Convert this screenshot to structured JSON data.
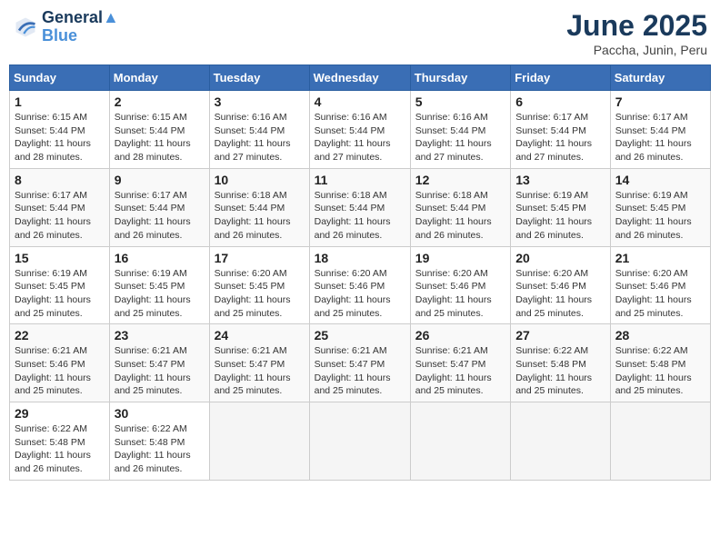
{
  "logo": {
    "line1": "General",
    "line2": "Blue"
  },
  "title": "June 2025",
  "subtitle": "Paccha, Junin, Peru",
  "days_of_week": [
    "Sunday",
    "Monday",
    "Tuesday",
    "Wednesday",
    "Thursday",
    "Friday",
    "Saturday"
  ],
  "weeks": [
    [
      {
        "day": 1,
        "info": "Sunrise: 6:15 AM\nSunset: 5:44 PM\nDaylight: 11 hours\nand 28 minutes."
      },
      {
        "day": 2,
        "info": "Sunrise: 6:15 AM\nSunset: 5:44 PM\nDaylight: 11 hours\nand 28 minutes."
      },
      {
        "day": 3,
        "info": "Sunrise: 6:16 AM\nSunset: 5:44 PM\nDaylight: 11 hours\nand 27 minutes."
      },
      {
        "day": 4,
        "info": "Sunrise: 6:16 AM\nSunset: 5:44 PM\nDaylight: 11 hours\nand 27 minutes."
      },
      {
        "day": 5,
        "info": "Sunrise: 6:16 AM\nSunset: 5:44 PM\nDaylight: 11 hours\nand 27 minutes."
      },
      {
        "day": 6,
        "info": "Sunrise: 6:17 AM\nSunset: 5:44 PM\nDaylight: 11 hours\nand 27 minutes."
      },
      {
        "day": 7,
        "info": "Sunrise: 6:17 AM\nSunset: 5:44 PM\nDaylight: 11 hours\nand 26 minutes."
      }
    ],
    [
      {
        "day": 8,
        "info": "Sunrise: 6:17 AM\nSunset: 5:44 PM\nDaylight: 11 hours\nand 26 minutes."
      },
      {
        "day": 9,
        "info": "Sunrise: 6:17 AM\nSunset: 5:44 PM\nDaylight: 11 hours\nand 26 minutes."
      },
      {
        "day": 10,
        "info": "Sunrise: 6:18 AM\nSunset: 5:44 PM\nDaylight: 11 hours\nand 26 minutes."
      },
      {
        "day": 11,
        "info": "Sunrise: 6:18 AM\nSunset: 5:44 PM\nDaylight: 11 hours\nand 26 minutes."
      },
      {
        "day": 12,
        "info": "Sunrise: 6:18 AM\nSunset: 5:44 PM\nDaylight: 11 hours\nand 26 minutes."
      },
      {
        "day": 13,
        "info": "Sunrise: 6:19 AM\nSunset: 5:45 PM\nDaylight: 11 hours\nand 26 minutes."
      },
      {
        "day": 14,
        "info": "Sunrise: 6:19 AM\nSunset: 5:45 PM\nDaylight: 11 hours\nand 26 minutes."
      }
    ],
    [
      {
        "day": 15,
        "info": "Sunrise: 6:19 AM\nSunset: 5:45 PM\nDaylight: 11 hours\nand 25 minutes."
      },
      {
        "day": 16,
        "info": "Sunrise: 6:19 AM\nSunset: 5:45 PM\nDaylight: 11 hours\nand 25 minutes."
      },
      {
        "day": 17,
        "info": "Sunrise: 6:20 AM\nSunset: 5:45 PM\nDaylight: 11 hours\nand 25 minutes."
      },
      {
        "day": 18,
        "info": "Sunrise: 6:20 AM\nSunset: 5:46 PM\nDaylight: 11 hours\nand 25 minutes."
      },
      {
        "day": 19,
        "info": "Sunrise: 6:20 AM\nSunset: 5:46 PM\nDaylight: 11 hours\nand 25 minutes."
      },
      {
        "day": 20,
        "info": "Sunrise: 6:20 AM\nSunset: 5:46 PM\nDaylight: 11 hours\nand 25 minutes."
      },
      {
        "day": 21,
        "info": "Sunrise: 6:20 AM\nSunset: 5:46 PM\nDaylight: 11 hours\nand 25 minutes."
      }
    ],
    [
      {
        "day": 22,
        "info": "Sunrise: 6:21 AM\nSunset: 5:46 PM\nDaylight: 11 hours\nand 25 minutes."
      },
      {
        "day": 23,
        "info": "Sunrise: 6:21 AM\nSunset: 5:47 PM\nDaylight: 11 hours\nand 25 minutes."
      },
      {
        "day": 24,
        "info": "Sunrise: 6:21 AM\nSunset: 5:47 PM\nDaylight: 11 hours\nand 25 minutes."
      },
      {
        "day": 25,
        "info": "Sunrise: 6:21 AM\nSunset: 5:47 PM\nDaylight: 11 hours\nand 25 minutes."
      },
      {
        "day": 26,
        "info": "Sunrise: 6:21 AM\nSunset: 5:47 PM\nDaylight: 11 hours\nand 25 minutes."
      },
      {
        "day": 27,
        "info": "Sunrise: 6:22 AM\nSunset: 5:48 PM\nDaylight: 11 hours\nand 25 minutes."
      },
      {
        "day": 28,
        "info": "Sunrise: 6:22 AM\nSunset: 5:48 PM\nDaylight: 11 hours\nand 25 minutes."
      }
    ],
    [
      {
        "day": 29,
        "info": "Sunrise: 6:22 AM\nSunset: 5:48 PM\nDaylight: 11 hours\nand 26 minutes."
      },
      {
        "day": 30,
        "info": "Sunrise: 6:22 AM\nSunset: 5:48 PM\nDaylight: 11 hours\nand 26 minutes."
      },
      null,
      null,
      null,
      null,
      null
    ]
  ]
}
